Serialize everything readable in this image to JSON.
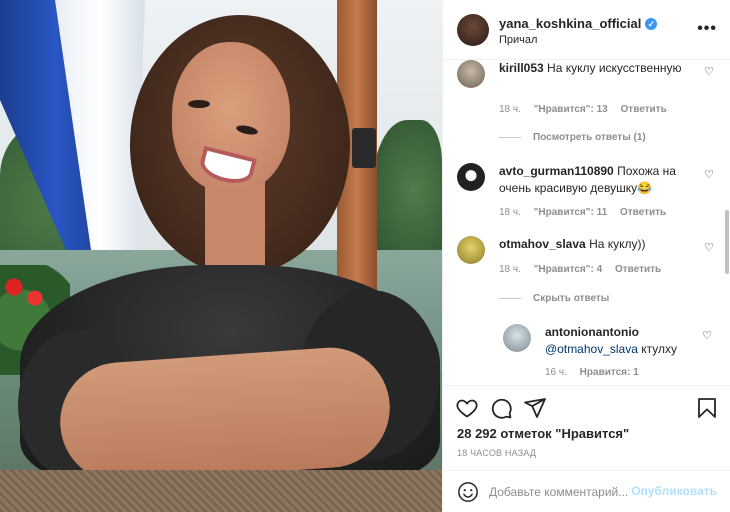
{
  "post": {
    "username": "yana_koshkina_official",
    "location": "Причал",
    "more_label": "•••"
  },
  "comments": [
    {
      "user": "kirill053",
      "text": "На куклу искусственную",
      "age": "18 ч.",
      "likes": "\"Нравится\": 13",
      "reply": "Ответить",
      "replies_toggle": "Посмотреть ответы (1)"
    },
    {
      "user": "avto_gurman110890",
      "text": "Похожа на очень красивую девушку😂",
      "age": "18 ч.",
      "likes": "\"Нравится\": 11",
      "reply": "Ответить"
    },
    {
      "user": "otmahov_slava",
      "text": "На куклу))",
      "age": "18 ч.",
      "likes": "\"Нравится\": 4",
      "reply": "Ответить",
      "replies_toggle": "Скрыть ответы"
    }
  ],
  "reply": {
    "user": "antonionantonio",
    "mention": "@otmahov_slava",
    "text": "ктулху",
    "age": "16 ч.",
    "likes": "Нравится: 1"
  },
  "likes_count": "28 292 отметок \"Нравится\"",
  "timestamp": "18 ЧАСОВ НАЗАД",
  "add_comment": {
    "placeholder": "Добавьте комментарий...",
    "publish": "Опубликовать"
  },
  "colors": {
    "verified": "#3897f0",
    "link": "#00376b",
    "muted": "#8e8e8e",
    "publish_disabled": "#b2dffc"
  },
  "icons": [
    "verified-icon",
    "more-icon",
    "heart-icon",
    "comment-icon",
    "share-icon",
    "bookmark-icon",
    "emoji-icon"
  ]
}
